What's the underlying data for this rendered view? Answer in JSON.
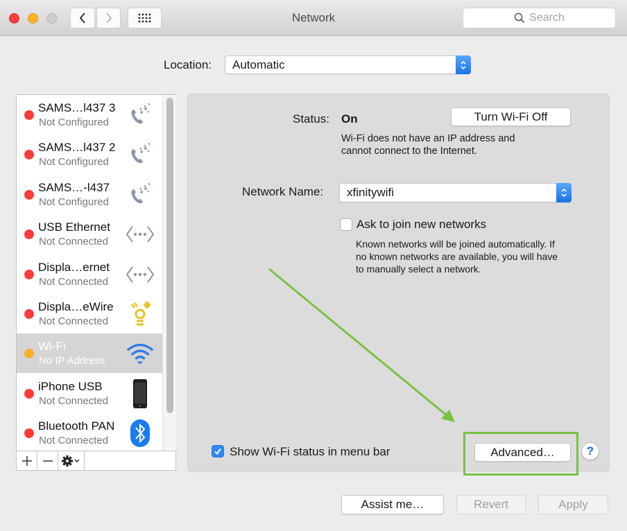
{
  "window": {
    "title": "Network",
    "search_placeholder": "Search",
    "nav": {
      "back": "back",
      "forward": "forward",
      "show_all": "show-all-grid"
    }
  },
  "location": {
    "label": "Location:",
    "value": "Automatic"
  },
  "services": [
    {
      "name": "SAMS…l437 3",
      "status": "Not Configured",
      "status_color": "#fc3d39",
      "icon": "phone-modem-icon",
      "selected": false
    },
    {
      "name": "SAMS…l437 2",
      "status": "Not Configured",
      "status_color": "#fc3d39",
      "icon": "phone-modem-icon",
      "selected": false
    },
    {
      "name": "SAMS…-l437",
      "status": "Not Configured",
      "status_color": "#fc3d39",
      "icon": "phone-modem-icon",
      "selected": false
    },
    {
      "name": "USB Ethernet",
      "status": "Not Connected",
      "status_color": "#fc3d39",
      "icon": "ethernet-icon",
      "selected": false
    },
    {
      "name": "Displa…ernet",
      "status": "Not Connected",
      "status_color": "#fc3d39",
      "icon": "ethernet-icon",
      "selected": false
    },
    {
      "name": "Displa…eWire",
      "status": "Not Connected",
      "status_color": "#fc3d39",
      "icon": "firewire-icon",
      "selected": false
    },
    {
      "name": "Wi-Fi",
      "status": "No IP Address",
      "status_color": "#f7b02a",
      "icon": "wifi-icon",
      "selected": true
    },
    {
      "name": "iPhone USB",
      "status": "Not Connected",
      "status_color": "#fc3d39",
      "icon": "iphone-icon",
      "selected": false
    },
    {
      "name": "Bluetooth PAN",
      "status": "Not Connected",
      "status_color": "#fc3d39",
      "icon": "bluetooth-icon",
      "selected": false
    }
  ],
  "sidebar_toolbar": {
    "add": "+",
    "remove": "—",
    "action": "gear"
  },
  "detail": {
    "status_label": "Status:",
    "status_value": "On",
    "turn_off_button": "Turn Wi-Fi Off",
    "status_description_1": "Wi-Fi does not have an IP address and",
    "status_description_2": "cannot connect to the Internet.",
    "network_name_label": "Network Name:",
    "network_name_value": "xfinitywifi",
    "ask_to_join_label": "Ask to join new networks",
    "ask_to_join_checked": false,
    "ask_description_1": "Known networks will be joined automatically. If",
    "ask_description_2": "no known networks are available, you will have",
    "ask_description_3": "to manually select a network.",
    "show_status_label": "Show Wi-Fi status in menu bar",
    "show_status_checked": true,
    "advanced_button": "Advanced…",
    "help_button": "?"
  },
  "footer": {
    "assist_button": "Assist me…",
    "revert_button": "Revert",
    "apply_button": "Apply"
  },
  "annotation": {
    "color": "#7ac143",
    "target": "advanced-button"
  }
}
